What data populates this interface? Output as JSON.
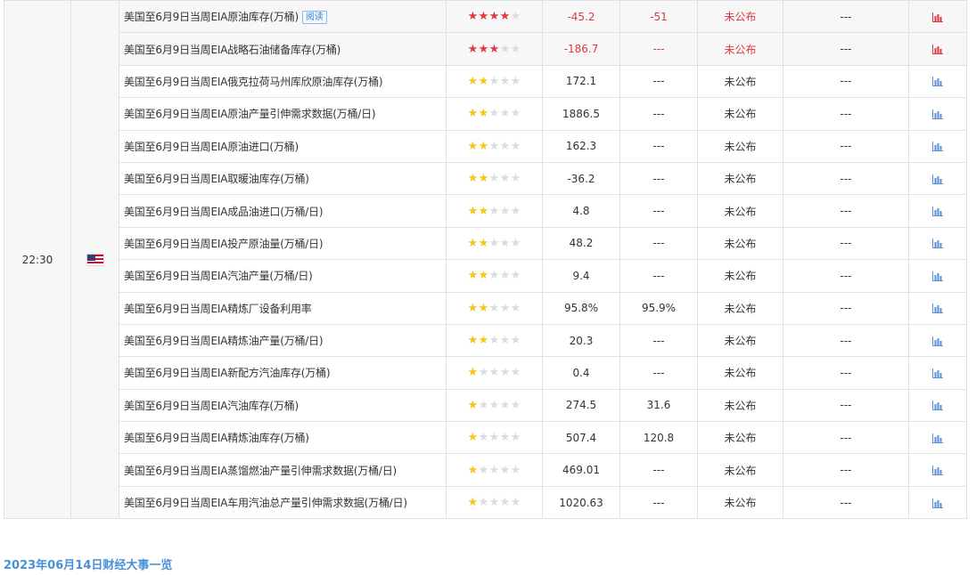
{
  "time": "22:30",
  "country_flag": "us-flag-icon",
  "colors": {
    "highlight": "#e0383e",
    "star_red": "#e0383e",
    "star_yellow": "#f5c517",
    "star_off": "#dcdcdc",
    "link": "#4a90d9",
    "chart_blue": "#5b8fd8",
    "chart_red": "#e0383e"
  },
  "tag_label": "阅读",
  "rows": [
    {
      "name": "美国至6月9日当周EIA原油库存(万桶)",
      "tag": true,
      "stars": 4,
      "importance": "high",
      "previous": "-45.2",
      "forecast": "-51",
      "actual": "未公布",
      "impact": "---"
    },
    {
      "name": "美国至6月9日当周EIA战略石油储备库存(万桶)",
      "tag": false,
      "stars": 3,
      "importance": "high",
      "previous": "-186.7",
      "forecast": "---",
      "actual": "未公布",
      "impact": "---"
    },
    {
      "name": "美国至6月9日当周EIA俄克拉荷马州库欣原油库存(万桶)",
      "tag": false,
      "stars": 2,
      "importance": "low",
      "previous": "172.1",
      "forecast": "---",
      "actual": "未公布",
      "impact": "---"
    },
    {
      "name": "美国至6月9日当周EIA原油产量引伸需求数据(万桶/日)",
      "tag": false,
      "stars": 2,
      "importance": "low",
      "previous": "1886.5",
      "forecast": "---",
      "actual": "未公布",
      "impact": "---"
    },
    {
      "name": "美国至6月9日当周EIA原油进口(万桶)",
      "tag": false,
      "stars": 2,
      "importance": "low",
      "previous": "162.3",
      "forecast": "---",
      "actual": "未公布",
      "impact": "---"
    },
    {
      "name": "美国至6月9日当周EIA取暖油库存(万桶)",
      "tag": false,
      "stars": 2,
      "importance": "low",
      "previous": "-36.2",
      "forecast": "---",
      "actual": "未公布",
      "impact": "---"
    },
    {
      "name": "美国至6月9日当周EIA成品油进口(万桶/日)",
      "tag": false,
      "stars": 2,
      "importance": "low",
      "previous": "4.8",
      "forecast": "---",
      "actual": "未公布",
      "impact": "---"
    },
    {
      "name": "美国至6月9日当周EIA投产原油量(万桶/日)",
      "tag": false,
      "stars": 2,
      "importance": "low",
      "previous": "48.2",
      "forecast": "---",
      "actual": "未公布",
      "impact": "---"
    },
    {
      "name": "美国至6月9日当周EIA汽油产量(万桶/日)",
      "tag": false,
      "stars": 2,
      "importance": "low",
      "previous": "9.4",
      "forecast": "---",
      "actual": "未公布",
      "impact": "---"
    },
    {
      "name": "美国至6月9日当周EIA精炼厂设备利用率",
      "tag": false,
      "stars": 2,
      "importance": "low",
      "previous": "95.8%",
      "forecast": "95.9%",
      "actual": "未公布",
      "impact": "---"
    },
    {
      "name": "美国至6月9日当周EIA精炼油产量(万桶/日)",
      "tag": false,
      "stars": 2,
      "importance": "low",
      "previous": "20.3",
      "forecast": "---",
      "actual": "未公布",
      "impact": "---"
    },
    {
      "name": "美国至6月9日当周EIA新配方汽油库存(万桶)",
      "tag": false,
      "stars": 1,
      "importance": "low",
      "previous": "0.4",
      "forecast": "---",
      "actual": "未公布",
      "impact": "---"
    },
    {
      "name": "美国至6月9日当周EIA汽油库存(万桶)",
      "tag": false,
      "stars": 1,
      "importance": "low",
      "previous": "274.5",
      "forecast": "31.6",
      "actual": "未公布",
      "impact": "---"
    },
    {
      "name": "美国至6月9日当周EIA精炼油库存(万桶)",
      "tag": false,
      "stars": 1,
      "importance": "low",
      "previous": "507.4",
      "forecast": "120.8",
      "actual": "未公布",
      "impact": "---"
    },
    {
      "name": "美国至6月9日当周EIA蒸馏燃油产量引伸需求数据(万桶/日)",
      "tag": false,
      "stars": 1,
      "importance": "low",
      "previous": "469.01",
      "forecast": "---",
      "actual": "未公布",
      "impact": "---"
    },
    {
      "name": "美国至6月9日当周EIA车用汽油总产量引伸需求数据(万桶/日)",
      "tag": false,
      "stars": 1,
      "importance": "low",
      "previous": "1020.63",
      "forecast": "---",
      "actual": "未公布",
      "impact": "---"
    }
  ],
  "footer_link": "2023年06月14日财经大事一览"
}
